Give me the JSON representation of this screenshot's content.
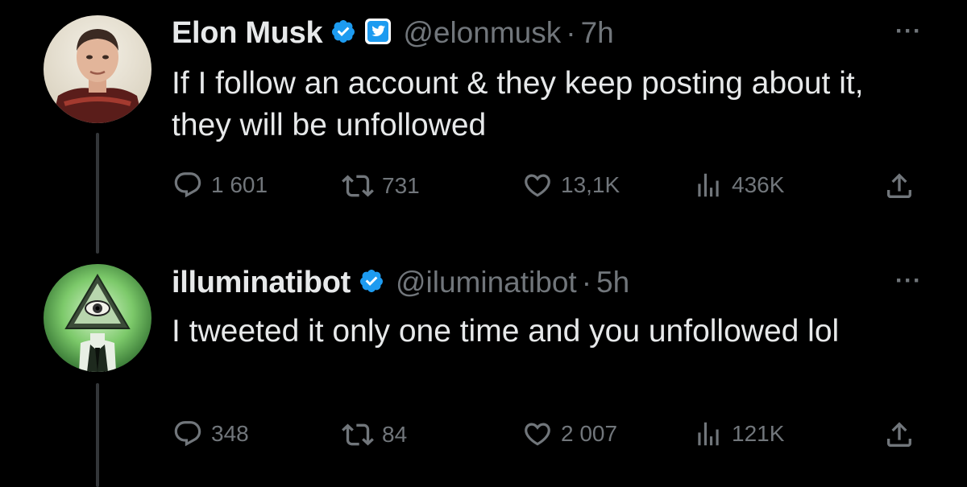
{
  "tweets": [
    {
      "name": "Elon Musk",
      "handle": "@elonmusk",
      "separator": "·",
      "time": "7h",
      "text": "If I follow an account & they keep posting about it, they will be unfollowed",
      "replies": "1 601",
      "retweets": "731",
      "likes": "13,1K",
      "views": "436K",
      "verified": true,
      "affiliate_badge": "twitter-bird-badge"
    },
    {
      "name": "illuminatibot",
      "handle": "@iluminatibot",
      "separator": "·",
      "time": "5h",
      "text": "I tweeted it only one time and you unfollowed lol",
      "replies": "348",
      "retweets": "84",
      "likes": "2 007",
      "views": "121K",
      "verified": true
    }
  ],
  "more_label": "···",
  "colors": {
    "background": "#000000",
    "text": "#e7e9ea",
    "secondary": "#71767b",
    "verified": "#1d9bf0",
    "thread_line": "#333639"
  }
}
